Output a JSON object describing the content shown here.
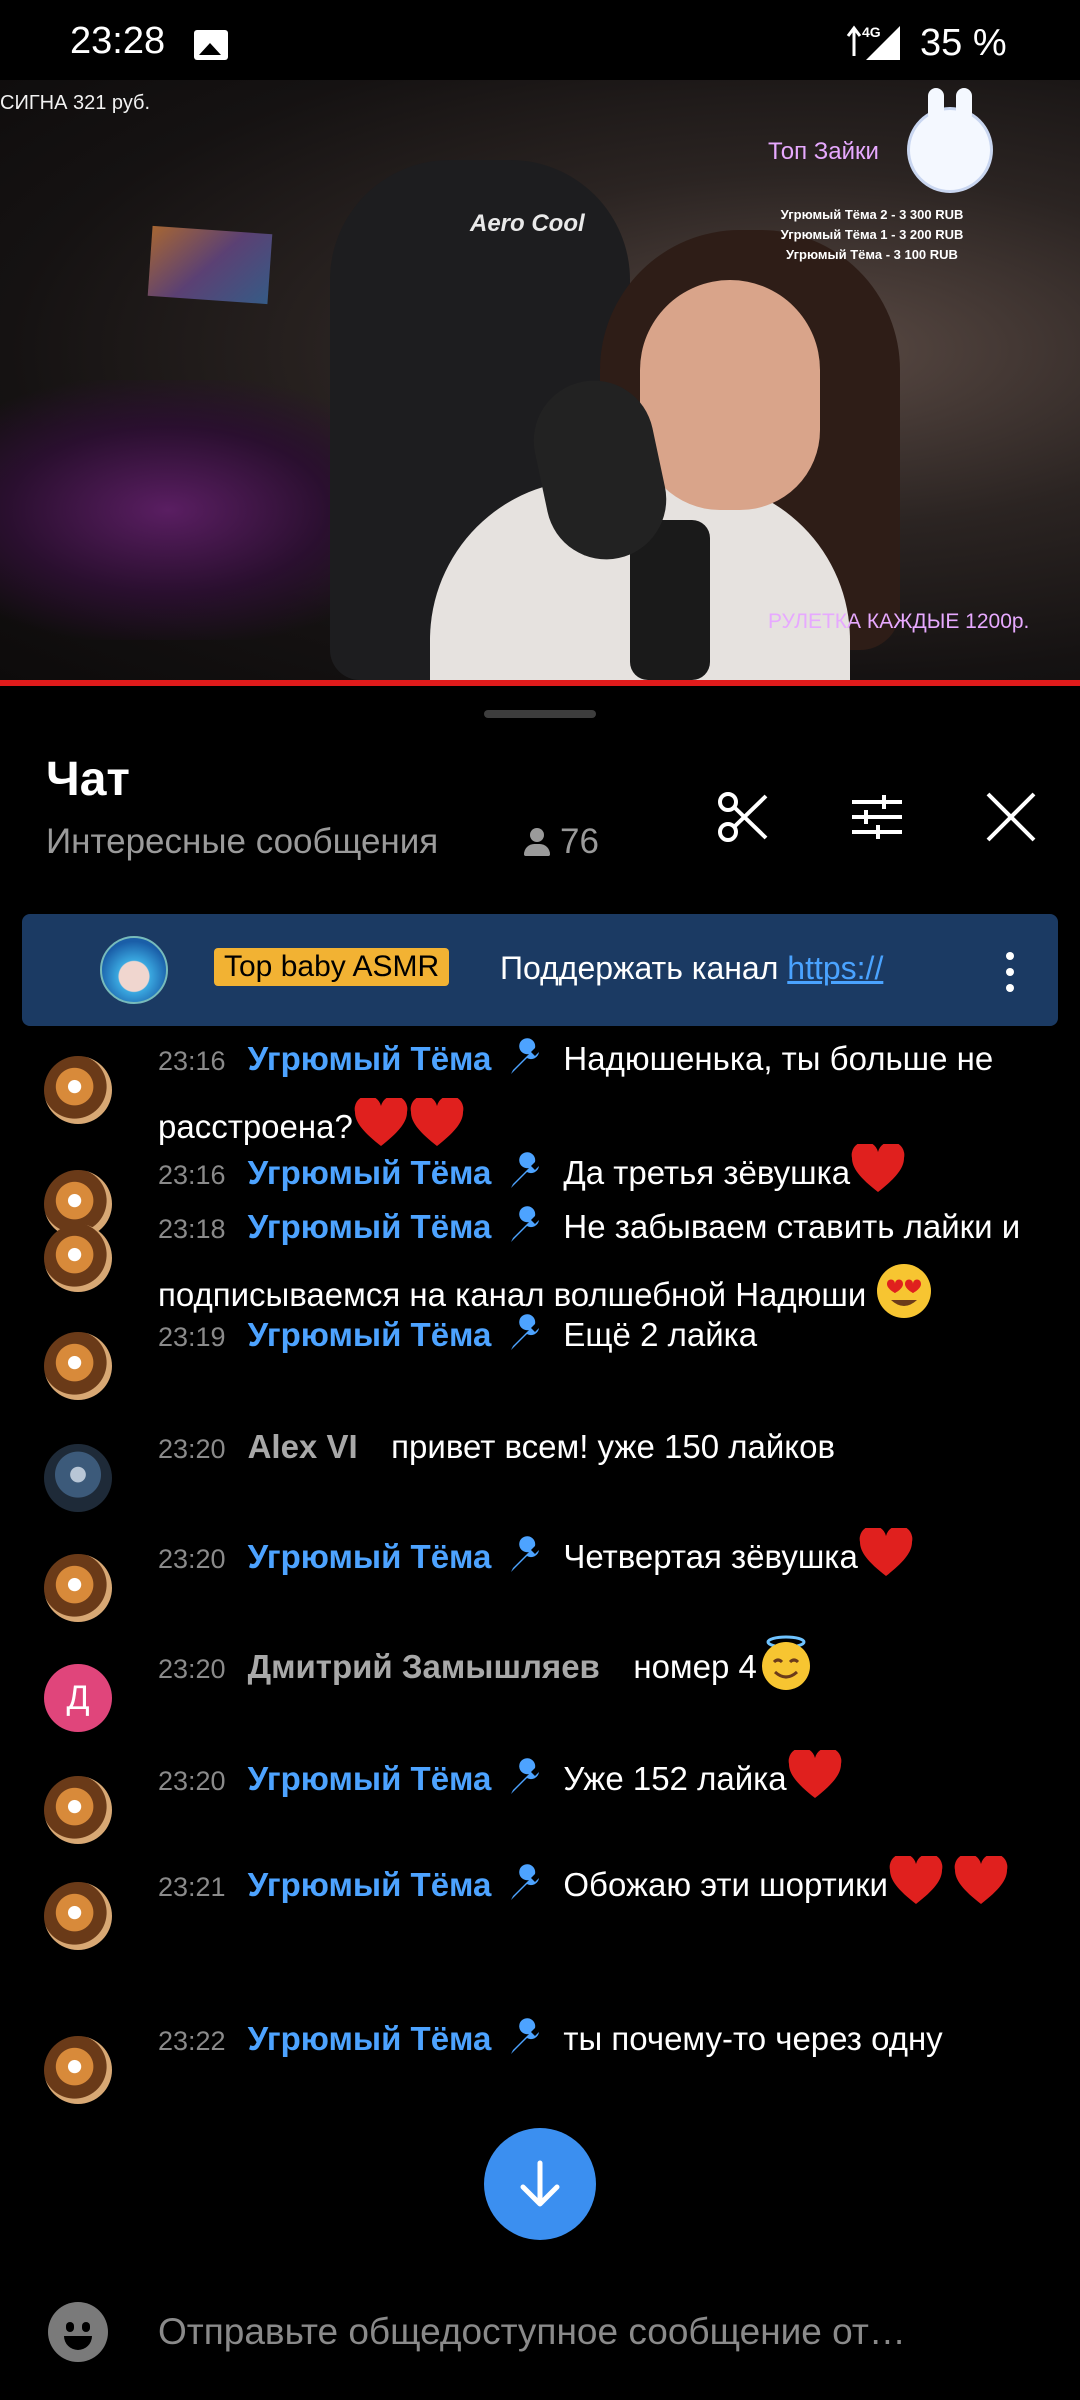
{
  "status_bar": {
    "time": "23:28",
    "network": "4G",
    "battery": "35 %"
  },
  "video": {
    "donation_line": "СИГНА 321 руб.",
    "chair_brand": "Aero Cool",
    "top_title": "Топ Зайки",
    "top_list": [
      "Угрюмый Тёма 2 - 3 300 RUB",
      "Угрюмый Тёма 1 - 3 200 RUB",
      "Угрюмый Тёма - 3 100 RUB"
    ],
    "roulette": "РУЛЕТКА КАЖДЫЕ 1200р.",
    "progress_fraction": 1.0,
    "colors": {
      "progress": "#e01b1b",
      "overlay_text": "#e7a9ff"
    }
  },
  "chat": {
    "title": "Чат",
    "subtitle": "Интересные сообщения",
    "viewers": "76",
    "icons": {
      "clip": "scissors-icon",
      "filter": "sliders-icon",
      "close": "close-icon"
    }
  },
  "pinned": {
    "badge": "Top baby ASMR",
    "text": "Поддержать канал ",
    "link": "https://",
    "colors": {
      "background": "#1b3a63",
      "badge": "#f2b233"
    }
  },
  "messages": [
    {
      "time": "23:16",
      "author": "Угрюмый Тёма",
      "text": "Надюшенька, ты больше не расстроена?"
    },
    {
      "time": "23:16",
      "author": "Угрюмый Тёма",
      "text": "Да третья зёвушка"
    },
    {
      "time": "23:18",
      "author": "Угрюмый Тёма",
      "text": "Не забываем ставить лайки и подписываемся на канал волшебной Надюши"
    },
    {
      "time": "23:19",
      "author": "Угрюмый Тёма",
      "text": "Ещё 2 лайка"
    },
    {
      "time": "23:20",
      "author": "Alex VI",
      "text": "привет всем! уже 150 лайков"
    },
    {
      "time": "23:20",
      "author": "Угрюмый Тёма",
      "text": "Четвертая зёвушка"
    },
    {
      "time": "23:20",
      "author": "Дмитрий Замышляев",
      "avatar_letter": "Д",
      "text": "номер 4"
    },
    {
      "time": "23:20",
      "author": "Угрюмый Тёма",
      "text": "Уже 152 лайка"
    },
    {
      "time": "23:21",
      "author": "Угрюмый Тёма",
      "text": "Обожаю эти шортики"
    },
    {
      "time": "23:22",
      "author": "Угрюмый Тёма",
      "text": "ты почему-то через одну"
    }
  ],
  "input": {
    "placeholder": "Отправьте общедоступное сообщение от…"
  },
  "accent_color": "#4da3ff"
}
